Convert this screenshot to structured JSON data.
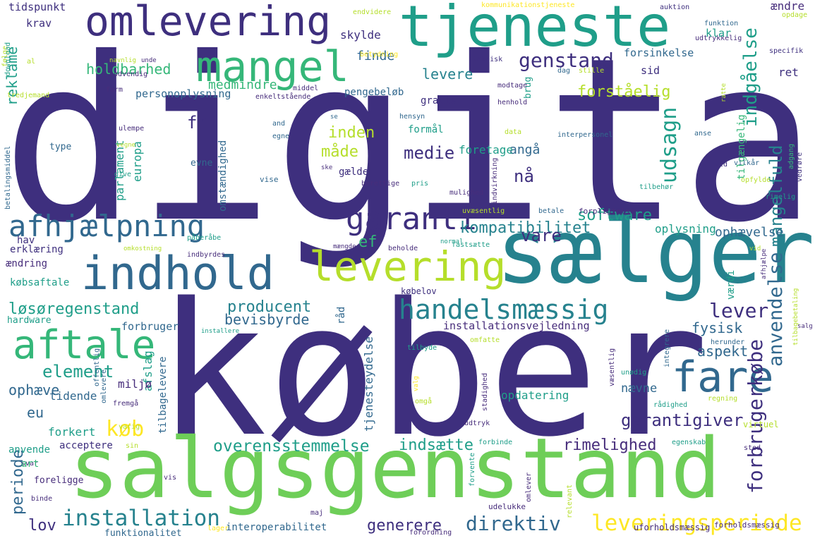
{
  "palette": {
    "indigo": "#3e2f7e",
    "purple": "#472d7b",
    "blue": "#31688e",
    "teal": "#26828e",
    "seagreen": "#1f9e89",
    "green": "#35b779",
    "lime": "#6ece58",
    "yellowgreen": "#b5de2b",
    "yellow": "#fde725",
    "deep": "#440154"
  },
  "words": [
    "digital",
    "køber",
    "salgsgenstand",
    "sælger",
    "tjeneste",
    "omlevering",
    "mangel",
    "indhold",
    "levering",
    "afhjælpning",
    "aftale",
    "handelsmæssig",
    "fare",
    "garanti",
    "leveringsperiode",
    "installation",
    "overensstemmelse",
    "genstand",
    "software",
    "kompatibilitet",
    "udsagn",
    "anvendelse",
    "forbrugerkøbe",
    "mangelfuld",
    "indgåelse",
    "løsøregenstand",
    "producent",
    "bevisbyrde",
    "garantigiver",
    "rimelighed",
    "indsætte",
    "direktiv",
    "generere",
    "element",
    "medie",
    "periode",
    "reklame",
    "holdbarhed",
    "medmindre",
    "forståelig",
    "lever",
    "vare",
    "fysisk",
    "aspekt",
    "ophævelse",
    "ophæve",
    "tidende",
    "afslag",
    "tilbagelevere",
    "interoperabilitet",
    "funktionalitet",
    "installationsvejledning",
    "tjenesteydelse",
    "personoplysning",
    "pengebeløb",
    "forsinkelse",
    "tilgængelig",
    "kommunikationstjeneste",
    "udtrykkelig",
    "funktion",
    "auktion",
    "ændre",
    "krav",
    "tidspunkt",
    "finde",
    "levere",
    "inden",
    "måde",
    "angå",
    "nå",
    "gratis",
    "formål",
    "foretage",
    "gælde",
    "skylde",
    "klar",
    "ret",
    "sid",
    "ef",
    "eu",
    "lov",
    "køb",
    "fri",
    "hav",
    "erklæring",
    "ændring",
    "købsaftale",
    "hardware",
    "forbruger",
    "miljø",
    "forkert",
    "anvende",
    "acceptere",
    "europa",
    "parlament",
    "type",
    "evne",
    "omstændighed",
    "oplysning",
    "nævne",
    "opdatering",
    "værdi",
    "købelov",
    "råd",
    "vise",
    "brug",
    "data",
    "tid",
    "vilkår",
    "rimelig",
    "opfylde",
    "betale",
    "forpligtelse",
    "uvæsentlig",
    "normal",
    "fastsætte",
    "beholde",
    "påberåbe",
    "omkostning",
    "indbyrdes",
    "mængde",
    "installere",
    "enkeltstående",
    "middel",
    "hensyn",
    "henhold",
    "modtage",
    "stille",
    "dag",
    "teknisk",
    "specifik",
    "nødvendig",
    "navnlig",
    "unde",
    "form",
    "ulempe",
    "vegne",
    "and",
    "egne",
    "se",
    "give",
    "ske",
    "pris",
    "berettige",
    "mulighed",
    "indvirkning",
    "tilbehør",
    "vedrøre",
    "adgang",
    "anse",
    "interpersonel",
    "betydning",
    "opdage",
    "endvidere",
    "følge",
    "download",
    "al",
    "tredjemand",
    "betalingsmiddel",
    "udelukke",
    "maj",
    "forordning",
    "lager",
    "forvente",
    "relevant",
    "omlever",
    "uforholdsmæssig",
    "forholdsmæssig",
    "forbinde",
    "egenskab",
    "sted",
    "virtuel",
    "regning",
    "unødig",
    "rådighed",
    "herunder",
    "integrere",
    "omfatte",
    "tilbyde",
    "væsentlig",
    "stadighed",
    "udtryk",
    "omgå",
    "valg",
    "offentlig",
    "omlevere",
    "fremgå",
    "varig",
    "sin",
    "svar",
    "art",
    "foreligge",
    "vis",
    "binde",
    "afhjælpe",
    "tilbagebetaling",
    "salg",
    "ratte",
    "vid"
  ]
}
